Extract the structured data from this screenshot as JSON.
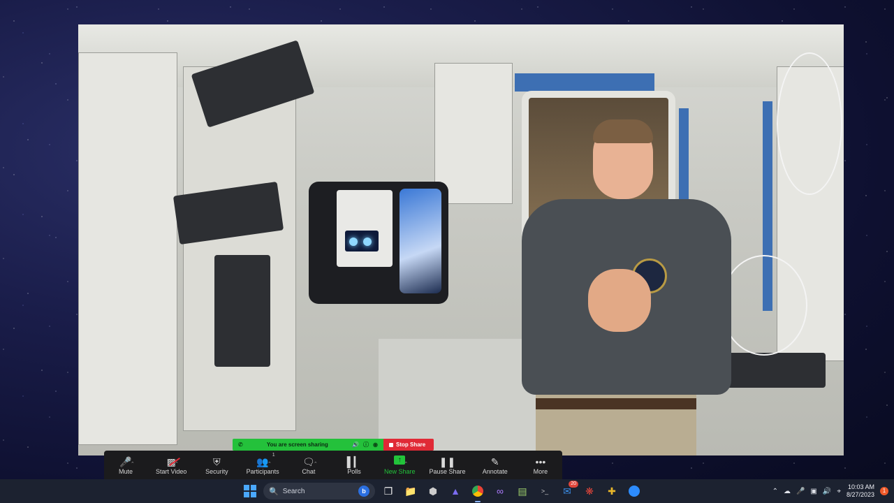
{
  "share_banner": {
    "status_text": "You are screen sharing",
    "stop_label": "Stop Share"
  },
  "toolbar": {
    "mute": "Mute",
    "start_video": "Start Video",
    "security": "Security",
    "participants": "Participants",
    "participants_count": "1",
    "chat": "Chat",
    "polls": "Polls",
    "new_share": "New Share",
    "pause_share": "Pause Share",
    "annotate": "Annotate",
    "more": "More"
  },
  "taskbar": {
    "search_placeholder": "Search",
    "teams_badge": "20",
    "time": "10:03 AM",
    "date": "8/27/2023",
    "notification_count": "1"
  },
  "colors": {
    "share_green": "#24c13b",
    "stop_red": "#e02a36",
    "toolbar_bg": "#1b1b1d",
    "taskbar_bg": "#1c2230"
  }
}
